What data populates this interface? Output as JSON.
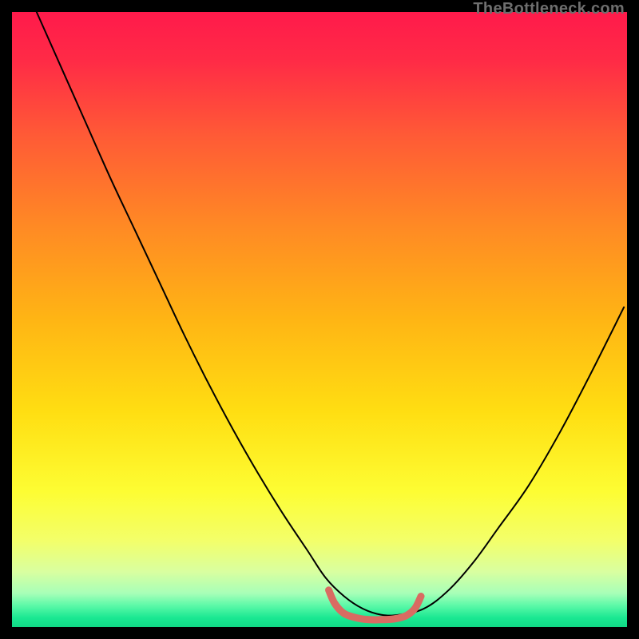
{
  "watermark": "TheBottleneck.com",
  "chart_data": {
    "type": "line",
    "title": "",
    "xlabel": "",
    "ylabel": "",
    "xlim": [
      0,
      100
    ],
    "ylim": [
      0,
      100
    ],
    "gradient_stops": [
      {
        "offset": 0.0,
        "color": "#ff1a4b"
      },
      {
        "offset": 0.08,
        "color": "#ff2b46"
      },
      {
        "offset": 0.2,
        "color": "#ff5a36"
      },
      {
        "offset": 0.35,
        "color": "#ff8a24"
      },
      {
        "offset": 0.5,
        "color": "#ffb514"
      },
      {
        "offset": 0.65,
        "color": "#ffde12"
      },
      {
        "offset": 0.78,
        "color": "#fdfd33"
      },
      {
        "offset": 0.86,
        "color": "#f3ff6a"
      },
      {
        "offset": 0.91,
        "color": "#d9ffa0"
      },
      {
        "offset": 0.945,
        "color": "#a8ffb8"
      },
      {
        "offset": 0.965,
        "color": "#5cf9a8"
      },
      {
        "offset": 0.985,
        "color": "#1ae892"
      },
      {
        "offset": 1.0,
        "color": "#11d985"
      }
    ],
    "series": [
      {
        "name": "bottleneck-curve",
        "color": "#000000",
        "x": [
          4,
          8,
          12,
          16,
          20,
          24,
          28,
          32,
          36,
          40,
          44,
          48,
          51,
          54,
          57,
          60,
          63,
          67,
          71,
          75,
          79,
          84,
          89,
          94,
          99.5
        ],
        "values": [
          100,
          91,
          82,
          73,
          64.5,
          56,
          47.5,
          39.5,
          32,
          25,
          18.5,
          12.5,
          8,
          5,
          3,
          2,
          2,
          3,
          6,
          10.5,
          16,
          23,
          31.5,
          41,
          52
        ]
      },
      {
        "name": "optimal-zone-marker",
        "color": "#d96b62",
        "x": [
          51.5,
          52.5,
          54,
          56,
          58,
          60,
          62,
          64,
          65.5,
          66.5
        ],
        "values": [
          6.0,
          3.8,
          2.2,
          1.5,
          1.2,
          1.2,
          1.3,
          1.8,
          3.0,
          5.0
        ]
      }
    ]
  }
}
